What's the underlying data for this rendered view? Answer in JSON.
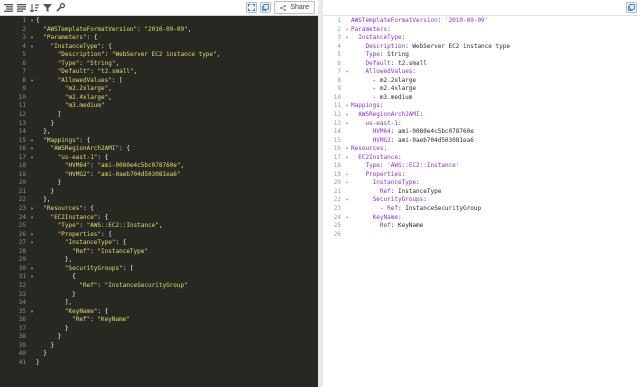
{
  "left": {
    "toolbar": {
      "icons": [
        "format-icon",
        "compact-icon",
        "sort-icon",
        "filter-icon",
        "repair-icon"
      ],
      "share_label": "Share"
    },
    "lines": [
      {
        "n": "1",
        "f": "▾",
        "t": [
          [
            "{",
            "p"
          ]
        ]
      },
      {
        "n": "2",
        "f": "",
        "t": [
          [
            "  ",
            "p"
          ],
          [
            "\"AWSTemplateFormatVersion\"",
            "k"
          ],
          [
            ": ",
            "p"
          ],
          [
            "\"2010-09-09\"",
            "s"
          ],
          [
            ",",
            "p"
          ]
        ]
      },
      {
        "n": "3",
        "f": "▾",
        "t": [
          [
            "  ",
            "p"
          ],
          [
            "\"Parameters\"",
            "k"
          ],
          [
            ": {",
            "p"
          ]
        ]
      },
      {
        "n": "4",
        "f": "▾",
        "t": [
          [
            "    ",
            "p"
          ],
          [
            "\"InstanceType\"",
            "k"
          ],
          [
            ": {",
            "p"
          ]
        ]
      },
      {
        "n": "5",
        "f": "",
        "t": [
          [
            "      ",
            "p"
          ],
          [
            "\"Description\"",
            "k"
          ],
          [
            ": ",
            "p"
          ],
          [
            "\"WebServer EC2 instance type\"",
            "s"
          ],
          [
            ",",
            "p"
          ]
        ]
      },
      {
        "n": "6",
        "f": "",
        "t": [
          [
            "      ",
            "p"
          ],
          [
            "\"Type\"",
            "k"
          ],
          [
            ": ",
            "p"
          ],
          [
            "\"String\"",
            "s"
          ],
          [
            ",",
            "p"
          ]
        ]
      },
      {
        "n": "7",
        "f": "",
        "t": [
          [
            "      ",
            "p"
          ],
          [
            "\"Default\"",
            "k"
          ],
          [
            ": ",
            "p"
          ],
          [
            "\"t2.small\"",
            "s"
          ],
          [
            ",",
            "p"
          ]
        ]
      },
      {
        "n": "8",
        "f": "▾",
        "t": [
          [
            "      ",
            "p"
          ],
          [
            "\"AllowedValues\"",
            "k"
          ],
          [
            ": [",
            "p"
          ]
        ]
      },
      {
        "n": "9",
        "f": "",
        "t": [
          [
            "        ",
            "p"
          ],
          [
            "\"m2.2xlarge\"",
            "s"
          ],
          [
            ",",
            "p"
          ]
        ]
      },
      {
        "n": "10",
        "f": "",
        "t": [
          [
            "        ",
            "p"
          ],
          [
            "\"m2.4xlarge\"",
            "s"
          ],
          [
            ",",
            "p"
          ]
        ]
      },
      {
        "n": "11",
        "f": "",
        "t": [
          [
            "        ",
            "p"
          ],
          [
            "\"m3.medium\"",
            "s"
          ]
        ]
      },
      {
        "n": "12",
        "f": "",
        "t": [
          [
            "      ]",
            "p"
          ]
        ]
      },
      {
        "n": "13",
        "f": "",
        "t": [
          [
            "    }",
            "p"
          ]
        ]
      },
      {
        "n": "14",
        "f": "",
        "t": [
          [
            "  },",
            "p"
          ]
        ]
      },
      {
        "n": "15",
        "f": "▾",
        "t": [
          [
            "  ",
            "p"
          ],
          [
            "\"Mappings\"",
            "k"
          ],
          [
            ": {",
            "p"
          ]
        ]
      },
      {
        "n": "16",
        "f": "▾",
        "t": [
          [
            "    ",
            "p"
          ],
          [
            "\"AWSRegionArch2AMI\"",
            "k"
          ],
          [
            ": {",
            "p"
          ]
        ]
      },
      {
        "n": "17",
        "f": "▾",
        "t": [
          [
            "      ",
            "p"
          ],
          [
            "\"us-east-1\"",
            "k"
          ],
          [
            ": {",
            "p"
          ]
        ]
      },
      {
        "n": "18",
        "f": "",
        "t": [
          [
            "        ",
            "p"
          ],
          [
            "\"HVM64\"",
            "k"
          ],
          [
            ": ",
            "p"
          ],
          [
            "\"ami-0080e4c5bc078760e\"",
            "s"
          ],
          [
            ",",
            "p"
          ]
        ]
      },
      {
        "n": "19",
        "f": "",
        "t": [
          [
            "        ",
            "p"
          ],
          [
            "\"HVMG2\"",
            "k"
          ],
          [
            ": ",
            "p"
          ],
          [
            "\"ami-0aeb704d503081ea6\"",
            "s"
          ]
        ]
      },
      {
        "n": "20",
        "f": "",
        "t": [
          [
            "      }",
            "p"
          ]
        ]
      },
      {
        "n": "21",
        "f": "",
        "t": [
          [
            "    }",
            "p"
          ]
        ]
      },
      {
        "n": "22",
        "f": "",
        "t": [
          [
            "  },",
            "p"
          ]
        ]
      },
      {
        "n": "23",
        "f": "▾",
        "t": [
          [
            "  ",
            "p"
          ],
          [
            "\"Resources\"",
            "k"
          ],
          [
            ": {",
            "p"
          ]
        ]
      },
      {
        "n": "24",
        "f": "▾",
        "t": [
          [
            "    ",
            "p"
          ],
          [
            "\"EC2Instance\"",
            "k"
          ],
          [
            ": {",
            "p"
          ]
        ]
      },
      {
        "n": "25",
        "f": "",
        "t": [
          [
            "      ",
            "p"
          ],
          [
            "\"Type\"",
            "k"
          ],
          [
            ": ",
            "p"
          ],
          [
            "\"AWS::EC2::Instance\"",
            "s"
          ],
          [
            ",",
            "p"
          ]
        ]
      },
      {
        "n": "26",
        "f": "▾",
        "t": [
          [
            "      ",
            "p"
          ],
          [
            "\"Properties\"",
            "k"
          ],
          [
            ": {",
            "p"
          ]
        ]
      },
      {
        "n": "27",
        "f": "▾",
        "t": [
          [
            "        ",
            "p"
          ],
          [
            "\"InstanceType\"",
            "k"
          ],
          [
            ": {",
            "p"
          ]
        ]
      },
      {
        "n": "28",
        "f": "",
        "t": [
          [
            "          ",
            "p"
          ],
          [
            "\"Ref\"",
            "k"
          ],
          [
            ": ",
            "p"
          ],
          [
            "\"InstanceType\"",
            "s"
          ]
        ]
      },
      {
        "n": "29",
        "f": "",
        "t": [
          [
            "        },",
            "p"
          ]
        ]
      },
      {
        "n": "30",
        "f": "▾",
        "t": [
          [
            "        ",
            "p"
          ],
          [
            "\"SecurityGroups\"",
            "k"
          ],
          [
            ": [",
            "p"
          ]
        ]
      },
      {
        "n": "31",
        "f": "▾",
        "t": [
          [
            "          {",
            "p"
          ]
        ]
      },
      {
        "n": "32",
        "f": "",
        "t": [
          [
            "            ",
            "p"
          ],
          [
            "\"Ref\"",
            "k"
          ],
          [
            ": ",
            "p"
          ],
          [
            "\"InstanceSecurityGroup\"",
            "s"
          ]
        ]
      },
      {
        "n": "33",
        "f": "",
        "t": [
          [
            "          }",
            "p"
          ]
        ]
      },
      {
        "n": "34",
        "f": "",
        "t": [
          [
            "        ],",
            "p"
          ]
        ]
      },
      {
        "n": "35",
        "f": "▾",
        "t": [
          [
            "        ",
            "p"
          ],
          [
            "\"KeyName\"",
            "k"
          ],
          [
            ": {",
            "p"
          ]
        ]
      },
      {
        "n": "36",
        "f": "",
        "t": [
          [
            "          ",
            "p"
          ],
          [
            "\"Ref\"",
            "k"
          ],
          [
            ": ",
            "p"
          ],
          [
            "\"KeyName\"",
            "s"
          ]
        ]
      },
      {
        "n": "37",
        "f": "",
        "t": [
          [
            "        }",
            "p"
          ]
        ]
      },
      {
        "n": "38",
        "f": "",
        "t": [
          [
            "      }",
            "p"
          ]
        ]
      },
      {
        "n": "39",
        "f": "",
        "t": [
          [
            "    }",
            "p"
          ]
        ]
      },
      {
        "n": "40",
        "f": "",
        "t": [
          [
            "  }",
            "p"
          ]
        ]
      },
      {
        "n": "41",
        "f": "",
        "t": [
          [
            "}",
            "p"
          ]
        ]
      }
    ]
  },
  "right": {
    "toolbar": {
      "icons": [
        "copy-icon"
      ]
    },
    "lines": [
      {
        "n": "1",
        "f": "",
        "t": [
          [
            "AWSTemplateFormatVersion",
            "k"
          ],
          [
            ": ",
            "p"
          ],
          [
            "'2010-09-09'",
            "s"
          ]
        ]
      },
      {
        "n": "2",
        "f": "▾",
        "t": [
          [
            "Parameters",
            "k"
          ],
          [
            ":",
            "p"
          ]
        ]
      },
      {
        "n": "3",
        "f": "▾",
        "t": [
          [
            "  ",
            "p"
          ],
          [
            "InstanceType",
            "k"
          ],
          [
            ":",
            "p"
          ]
        ]
      },
      {
        "n": "4",
        "f": "",
        "t": [
          [
            "    ",
            "p"
          ],
          [
            "Description",
            "k"
          ],
          [
            ": WebServer EC2 instance type",
            "p"
          ]
        ]
      },
      {
        "n": "5",
        "f": "",
        "t": [
          [
            "    ",
            "p"
          ],
          [
            "Type",
            "k"
          ],
          [
            ": String",
            "p"
          ]
        ]
      },
      {
        "n": "6",
        "f": "",
        "t": [
          [
            "    ",
            "p"
          ],
          [
            "Default",
            "k"
          ],
          [
            ": t2.small",
            "p"
          ]
        ]
      },
      {
        "n": "7",
        "f": "▾",
        "t": [
          [
            "    ",
            "p"
          ],
          [
            "AllowedValues",
            "k"
          ],
          [
            ":",
            "p"
          ]
        ]
      },
      {
        "n": "8",
        "f": "",
        "t": [
          [
            "      - m2.2xlarge",
            "p"
          ]
        ]
      },
      {
        "n": "9",
        "f": "",
        "t": [
          [
            "      - m2.4xlarge",
            "p"
          ]
        ]
      },
      {
        "n": "10",
        "f": "",
        "t": [
          [
            "      - m3.medium",
            "p"
          ]
        ]
      },
      {
        "n": "11",
        "f": "▾",
        "t": [
          [
            "Mappings",
            "k"
          ],
          [
            ":",
            "p"
          ]
        ]
      },
      {
        "n": "12",
        "f": "▾",
        "t": [
          [
            "  ",
            "p"
          ],
          [
            "AWSRegionArch2AMI",
            "k"
          ],
          [
            ":",
            "p"
          ]
        ]
      },
      {
        "n": "13",
        "f": "▾",
        "t": [
          [
            "    ",
            "p"
          ],
          [
            "us-east-1",
            "k"
          ],
          [
            ":",
            "p"
          ]
        ]
      },
      {
        "n": "14",
        "f": "",
        "t": [
          [
            "      ",
            "p"
          ],
          [
            "HVM64",
            "k"
          ],
          [
            ": ami-0080e4c5bc078760e",
            "p"
          ]
        ]
      },
      {
        "n": "15",
        "f": "",
        "t": [
          [
            "      ",
            "p"
          ],
          [
            "HVMG2",
            "k"
          ],
          [
            ": ami-0aeb704d503081ea6",
            "p"
          ]
        ]
      },
      {
        "n": "16",
        "f": "▾",
        "t": [
          [
            "Resources",
            "k"
          ],
          [
            ":",
            "p"
          ]
        ]
      },
      {
        "n": "17",
        "f": "▾",
        "t": [
          [
            "  ",
            "p"
          ],
          [
            "EC2Instance",
            "k"
          ],
          [
            ":",
            "p"
          ]
        ]
      },
      {
        "n": "18",
        "f": "",
        "t": [
          [
            "    ",
            "p"
          ],
          [
            "Type",
            "k"
          ],
          [
            ": ",
            "p"
          ],
          [
            "'AWS::EC2::Instance'",
            "s"
          ]
        ]
      },
      {
        "n": "19",
        "f": "▾",
        "t": [
          [
            "    ",
            "p"
          ],
          [
            "Properties",
            "k"
          ],
          [
            ":",
            "p"
          ]
        ]
      },
      {
        "n": "20",
        "f": "▾",
        "t": [
          [
            "      ",
            "p"
          ],
          [
            "InstanceType",
            "k"
          ],
          [
            ":",
            "p"
          ]
        ]
      },
      {
        "n": "21",
        "f": "",
        "t": [
          [
            "        ",
            "p"
          ],
          [
            "Ref",
            "k"
          ],
          [
            ": InstanceType",
            "p"
          ]
        ]
      },
      {
        "n": "22",
        "f": "▾",
        "t": [
          [
            "      ",
            "p"
          ],
          [
            "SecurityGroups",
            "k"
          ],
          [
            ":",
            "p"
          ]
        ]
      },
      {
        "n": "23",
        "f": "",
        "t": [
          [
            "        - ",
            "p"
          ],
          [
            "Ref",
            "k"
          ],
          [
            ": InstanceSecurityGroup",
            "p"
          ]
        ]
      },
      {
        "n": "24",
        "f": "▾",
        "t": [
          [
            "      ",
            "p"
          ],
          [
            "KeyName",
            "k"
          ],
          [
            ":",
            "p"
          ]
        ]
      },
      {
        "n": "25",
        "f": "",
        "t": [
          [
            "        ",
            "p"
          ],
          [
            "Ref",
            "k"
          ],
          [
            ": KeyName",
            "p"
          ]
        ]
      },
      {
        "n": "26",
        "f": "",
        "t": []
      }
    ]
  }
}
